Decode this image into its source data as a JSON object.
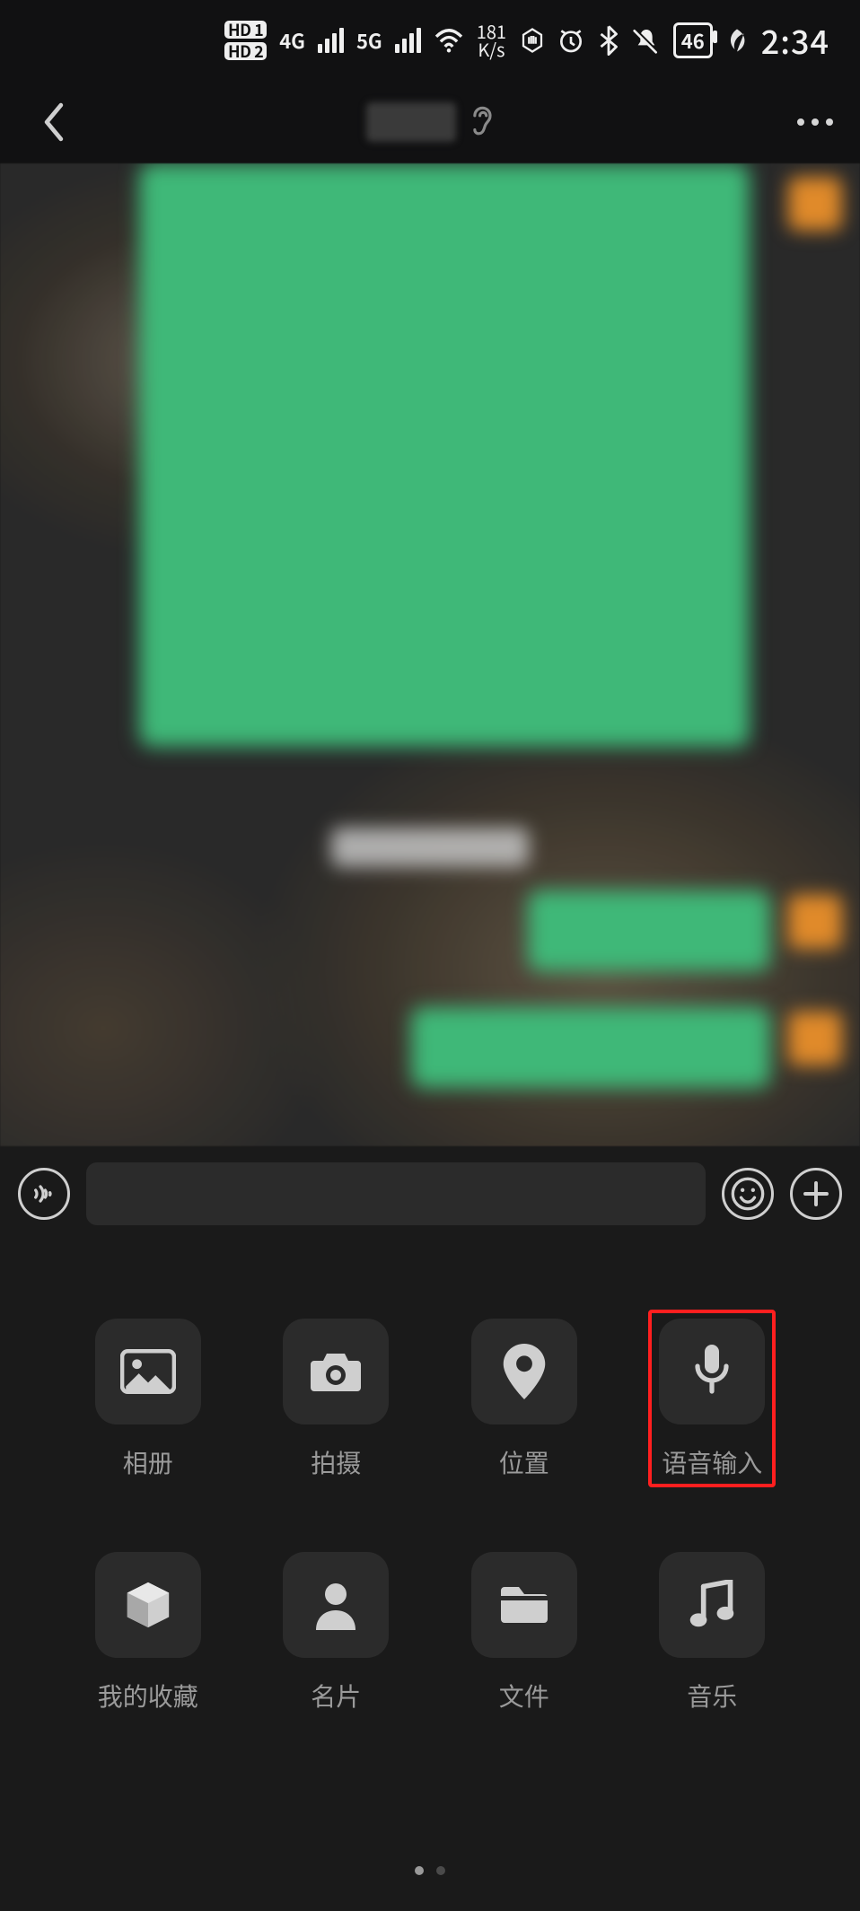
{
  "status": {
    "hd1": "HD 1",
    "hd2": "HD 2",
    "net1": "4G",
    "net2": "5G",
    "speed_val": "181",
    "speed_unit": "K/s",
    "battery": "46",
    "time": "2:34"
  },
  "header": {
    "ear_label": "earpiece-mode"
  },
  "attach": {
    "items": [
      {
        "label": "相册",
        "icon": "image-icon"
      },
      {
        "label": "拍摄",
        "icon": "camera-icon"
      },
      {
        "label": "位置",
        "icon": "location-pin-icon"
      },
      {
        "label": "语音输入",
        "icon": "microphone-icon",
        "highlighted": true
      },
      {
        "label": "我的收藏",
        "icon": "cube-icon"
      },
      {
        "label": "名片",
        "icon": "person-icon"
      },
      {
        "label": "文件",
        "icon": "folder-icon"
      },
      {
        "label": "音乐",
        "icon": "music-note-icon"
      }
    ],
    "page_count": 2,
    "active_page": 0
  },
  "colors": {
    "bubble_green": "#3fb878",
    "avatar_orange": "#e08a2a",
    "highlight_red": "#ff1f1f"
  }
}
